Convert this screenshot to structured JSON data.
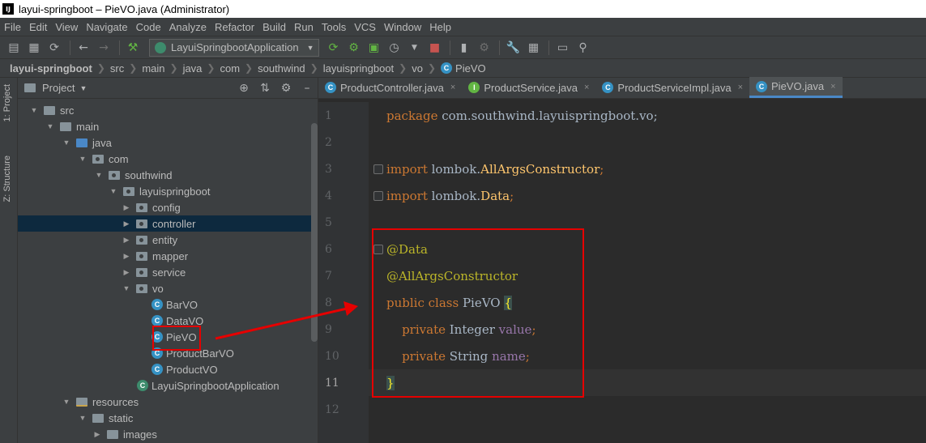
{
  "window": {
    "title": "layui-springboot – PieVO.java (Administrator)",
    "app_icon": "IJ"
  },
  "menu": [
    "File",
    "Edit",
    "View",
    "Navigate",
    "Code",
    "Analyze",
    "Refactor",
    "Build",
    "Run",
    "Tools",
    "VCS",
    "Window",
    "Help"
  ],
  "toolbar": {
    "run_config": "LayuiSpringbootApplication"
  },
  "breadcrumb": [
    "layui-springboot",
    "src",
    "main",
    "java",
    "com",
    "southwind",
    "layuispringboot",
    "vo",
    "PieVO"
  ],
  "side_tabs": [
    "1: Project",
    "Z: Structure"
  ],
  "project_panel": {
    "title": "Project",
    "tree": [
      {
        "label": "src",
        "kind": "folder"
      },
      {
        "label": "main",
        "kind": "folder"
      },
      {
        "label": "java",
        "kind": "folder"
      },
      {
        "label": "com",
        "kind": "package"
      },
      {
        "label": "southwind",
        "kind": "package"
      },
      {
        "label": "layuispringboot",
        "kind": "package"
      },
      {
        "label": "config",
        "kind": "package"
      },
      {
        "label": "controller",
        "kind": "package"
      },
      {
        "label": "entity",
        "kind": "package"
      },
      {
        "label": "mapper",
        "kind": "package"
      },
      {
        "label": "service",
        "kind": "package"
      },
      {
        "label": "vo",
        "kind": "package"
      },
      {
        "label": "BarVO",
        "kind": "class"
      },
      {
        "label": "DataVO",
        "kind": "class"
      },
      {
        "label": "PieVO",
        "kind": "class"
      },
      {
        "label": "ProductBarVO",
        "kind": "class"
      },
      {
        "label": "ProductVO",
        "kind": "class"
      },
      {
        "label": "LayuiSpringbootApplication",
        "kind": "spring-class"
      },
      {
        "label": "resources",
        "kind": "resources"
      },
      {
        "label": "static",
        "kind": "folder"
      },
      {
        "label": "images",
        "kind": "folder"
      }
    ]
  },
  "tabs": [
    {
      "label": "ProductController.java",
      "icon": "C"
    },
    {
      "label": "ProductService.java",
      "icon": "I"
    },
    {
      "label": "ProductServiceImpl.java",
      "icon": "C"
    },
    {
      "label": "PieVO.java",
      "icon": "C",
      "active": true
    }
  ],
  "editor": {
    "line_numbers": [
      "1",
      "2",
      "3",
      "4",
      "5",
      "6",
      "7",
      "8",
      "9",
      "10",
      "11",
      "12"
    ],
    "current_line": "11",
    "code": {
      "l1_kw": "package",
      "l1_rest": " com.southwind.layuispringboot.vo;",
      "l3_kw": "import",
      "l3_pkg": " lombok.",
      "l3_cls": "AllArgsConstructor",
      "l3_semi": ";",
      "l4_kw": "import",
      "l4_pkg": " lombok.",
      "l4_cls": "Data",
      "l4_semi": ";",
      "l6": "@Data",
      "l7": "@AllArgsConstructor",
      "l8_kw": "public class",
      "l8_name": " PieVO ",
      "l8_brace": "{",
      "l9_kw": "private",
      "l9_type": " Integer ",
      "l9_field": "value",
      "l9_semi": ";",
      "l10_kw": "private",
      "l10_type": " String ",
      "l10_field": "name",
      "l10_semi": ";",
      "l11": "}"
    }
  },
  "colors": {
    "annotation_red": "#e60000",
    "keyword": "#cc7832",
    "annotation": "#bbb529",
    "field": "#9876aa"
  }
}
